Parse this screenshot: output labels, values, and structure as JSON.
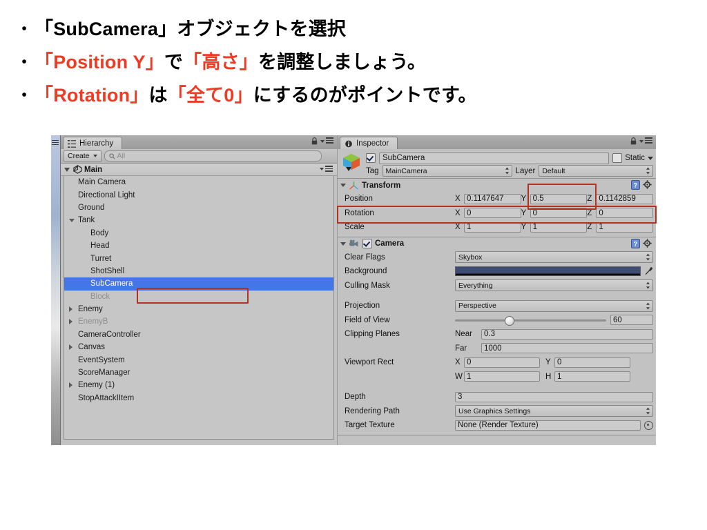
{
  "slide": {
    "bullets": [
      {
        "dot": "•",
        "segments": [
          {
            "text": "「SubCamera」オブジェクトを選択",
            "color": "black"
          }
        ]
      },
      {
        "dot": "•",
        "segments": [
          {
            "text": "「Position Y」",
            "color": "red"
          },
          {
            "text": "で",
            "color": "black"
          },
          {
            "text": "「高さ」",
            "color": "red"
          },
          {
            "text": "を調整しましょう。",
            "color": "black"
          }
        ]
      },
      {
        "dot": "•",
        "segments": [
          {
            "text": "「Rotation」",
            "color": "red"
          },
          {
            "text": "は",
            "color": "black"
          },
          {
            "text": "「全て0」",
            "color": "red"
          },
          {
            "text": "にするのがポイントです。",
            "color": "black"
          }
        ]
      }
    ],
    "accent_color": "#ef3b24",
    "text_color": "#000000"
  },
  "hierarchy": {
    "tab_label": "Hierarchy",
    "tab_icon": "hierarchy-icon",
    "lock_icon": "lock-icon",
    "menu_icon": "panel-menu-icon",
    "create_label": "Create",
    "search_placeholder": "All",
    "search_value": "",
    "search_icon": "search-icon",
    "scene_name": "Main",
    "scene_icon": "unity-logo-icon",
    "items": [
      {
        "label": "Main Camera",
        "indent": 1,
        "caret": "none",
        "dim": false,
        "selected": false
      },
      {
        "label": "Directional Light",
        "indent": 1,
        "caret": "none",
        "dim": false,
        "selected": false
      },
      {
        "label": "Ground",
        "indent": 1,
        "caret": "none",
        "dim": false,
        "selected": false
      },
      {
        "label": "Tank",
        "indent": 1,
        "caret": "open",
        "dim": false,
        "selected": false
      },
      {
        "label": "Body",
        "indent": 2,
        "caret": "none",
        "dim": false,
        "selected": false
      },
      {
        "label": "Head",
        "indent": 2,
        "caret": "none",
        "dim": false,
        "selected": false
      },
      {
        "label": "Turret",
        "indent": 2,
        "caret": "none",
        "dim": false,
        "selected": false
      },
      {
        "label": "ShotShell",
        "indent": 2,
        "caret": "none",
        "dim": false,
        "selected": false
      },
      {
        "label": "SubCamera",
        "indent": 2,
        "caret": "none",
        "dim": false,
        "selected": true
      },
      {
        "label": "Block",
        "indent": 2,
        "caret": "none",
        "dim": true,
        "selected": false
      },
      {
        "label": "Enemy",
        "indent": 1,
        "caret": "closed",
        "dim": false,
        "selected": false
      },
      {
        "label": "EnemyB",
        "indent": 1,
        "caret": "closed",
        "dim": true,
        "selected": false
      },
      {
        "label": "CameraController",
        "indent": 1,
        "caret": "none",
        "dim": false,
        "selected": false
      },
      {
        "label": "Canvas",
        "indent": 1,
        "caret": "closed",
        "dim": false,
        "selected": false
      },
      {
        "label": "EventSystem",
        "indent": 1,
        "caret": "none",
        "dim": false,
        "selected": false
      },
      {
        "label": "ScoreManager",
        "indent": 1,
        "caret": "none",
        "dim": false,
        "selected": false
      },
      {
        "label": "Enemy (1)",
        "indent": 1,
        "caret": "closed",
        "dim": false,
        "selected": false
      },
      {
        "label": "StopAttackIItem",
        "indent": 1,
        "caret": "none",
        "dim": false,
        "selected": false
      }
    ],
    "selection_color": "#4476e8"
  },
  "inspector": {
    "tab_label": "Inspector",
    "tab_icon": "info-icon",
    "lock_icon": "lock-icon",
    "menu_icon": "panel-menu-icon",
    "object": {
      "icon": "prefab-cube-icon",
      "enabled": true,
      "name": "SubCamera",
      "static_label": "Static",
      "static_checked": false,
      "tag_label": "Tag",
      "tag_value": "MainCamera",
      "layer_label": "Layer",
      "layer_value": "Default"
    },
    "transform": {
      "title": "Transform",
      "icon": "transform-axis-icon",
      "help_icon": "help-book-icon",
      "gear_icon": "gear-icon",
      "rows": [
        {
          "label": "Position",
          "x": "0.1147647",
          "y": "0.5",
          "z": "0.1142859"
        },
        {
          "label": "Rotation",
          "x": "0",
          "y": "0",
          "z": "0"
        },
        {
          "label": "Scale",
          "x": "1",
          "y": "1",
          "z": "1"
        }
      ],
      "axis_labels": [
        "X",
        "Y",
        "Z"
      ]
    },
    "camera": {
      "title": "Camera",
      "icon": "camera-icon",
      "enabled": true,
      "help_icon": "help-book-icon",
      "gear_icon": "gear-icon",
      "clear_flags_label": "Clear Flags",
      "clear_flags_value": "Skybox",
      "background_label": "Background",
      "background_color": "#3d4c72",
      "picker_icon": "eyedropper-icon",
      "culling_mask_label": "Culling Mask",
      "culling_mask_value": "Everything",
      "projection_label": "Projection",
      "projection_value": "Perspective",
      "fov_label": "Field of View",
      "fov_value": "60",
      "clipping_label": "Clipping Planes",
      "near_label": "Near",
      "near_value": "0.3",
      "far_label": "Far",
      "far_value": "1000",
      "viewport_label": "Viewport Rect",
      "viewport_x_label": "X",
      "viewport_x": "0",
      "viewport_y_label": "Y",
      "viewport_y": "0",
      "viewport_w_label": "W",
      "viewport_w": "1",
      "viewport_h_label": "H",
      "viewport_h": "1",
      "depth_label": "Depth",
      "depth_value": "3",
      "rendering_path_label": "Rendering Path",
      "rendering_path_value": "Use Graphics Settings",
      "target_texture_label": "Target Texture",
      "target_texture_value": "None (Render Texture)",
      "object_picker_icon": "object-picker-icon"
    }
  },
  "annotations": {
    "color": "#b1331f",
    "boxes": [
      "hierarchy-subcamera-highlight",
      "position-y-highlight",
      "rotation-row-highlight"
    ]
  }
}
